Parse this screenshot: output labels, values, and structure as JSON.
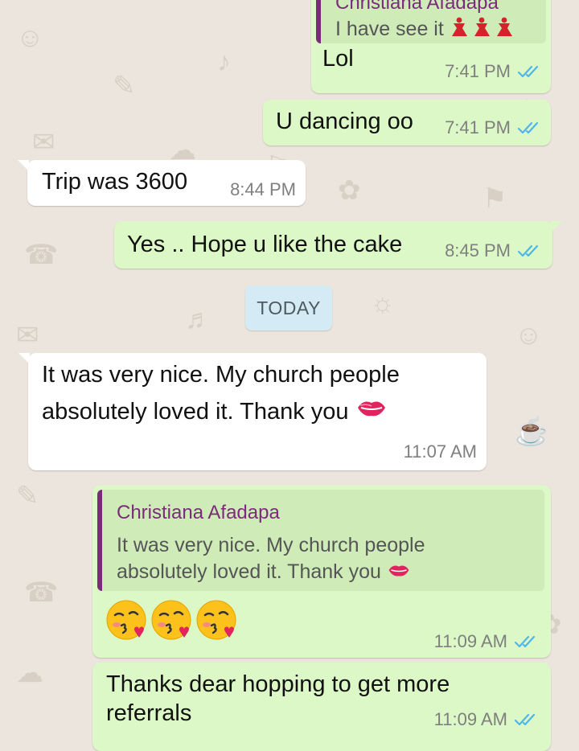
{
  "colors": {
    "outgoing_bubble": "#dcf8c6",
    "incoming_bubble": "#ffffff",
    "quote_bar": "#7b2a7c",
    "read_ticks": "#4fb6ec",
    "date_chip": "#d4eaf4",
    "background": "#ece5dd"
  },
  "messages": {
    "m1": {
      "quoted_name": "Christiana Afadapa",
      "quoted_text": "I have see it",
      "quoted_emoji": "dancer-emoji x3",
      "text": "Lol",
      "time": "7:41 PM",
      "status": "read-double-tick-icon"
    },
    "m2": {
      "text": "U dancing oo",
      "time": "7:41 PM",
      "status": "read-double-tick-icon"
    },
    "m3": {
      "text": "Trip was 3600",
      "time": "8:44 PM"
    },
    "m4": {
      "text": "Yes .. Hope u like the cake",
      "time": "8:45 PM",
      "status": "read-double-tick-icon"
    },
    "date_separator": "TODAY",
    "m5": {
      "line1": "It was very nice. My church people",
      "line2": "absolutely loved it. Thank you",
      "emoji": "kiss-lips-emoji",
      "time": "11:07 AM"
    },
    "m6": {
      "quoted_name": "Christiana Afadapa",
      "quoted_line1": "It was very nice. My church people",
      "quoted_line2": "absolutely loved it. Thank you",
      "emoji": "face-blowing-kiss-emoji x3",
      "time": "11:09 AM",
      "status": "read-double-tick-icon"
    },
    "m7": {
      "line1": "Thanks dear hopping to get more",
      "line2": "referrals",
      "time": "11:09 AM",
      "status": "read-double-tick-icon"
    }
  }
}
